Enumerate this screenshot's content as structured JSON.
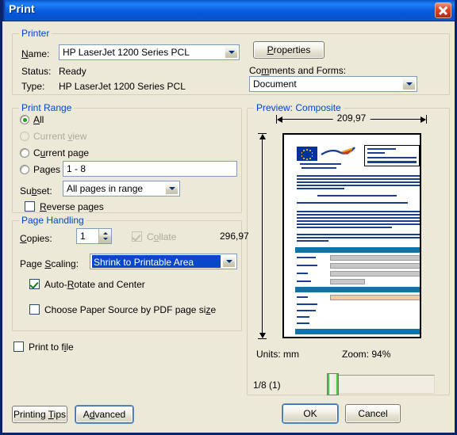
{
  "window": {
    "title": "Print",
    "close_label": "Close"
  },
  "printer": {
    "legend": "Printer",
    "name_label": "Name:",
    "name_value": "HP LaserJet 1200 Series PCL",
    "status_label": "Status:",
    "status_value": "Ready",
    "type_label": "Type:",
    "type_value": "HP LaserJet 1200 Series PCL",
    "properties_button": "Properties",
    "comments_label": "Comments and Forms:",
    "comments_value": "Document"
  },
  "print_range": {
    "legend": "Print Range",
    "all_label": "All",
    "all_checked": true,
    "current_view_label": "Current view",
    "current_view_enabled": false,
    "current_page_label": "Current page",
    "pages_label": "Pages",
    "pages_value": "1 - 8",
    "subset_label": "Subset:",
    "subset_value": "All pages in range",
    "reverse_label": "Reverse pages",
    "reverse_checked": false
  },
  "page_handling": {
    "legend": "Page Handling",
    "copies_label": "Copies:",
    "copies_value": "1",
    "collate_label": "Collate",
    "collate_checked": true,
    "collate_enabled": false,
    "scaling_label": "Page Scaling:",
    "scaling_value": "Shrink to Printable Area",
    "autorotate_label": "Auto-Rotate and Center",
    "autorotate_checked": true,
    "papersource_label": "Choose Paper Source by PDF page size",
    "papersource_checked": false
  },
  "print_to_file": {
    "label": "Print to file",
    "checked": false
  },
  "preview": {
    "legend": "Preview: Composite",
    "width_mm": "209,97",
    "height_mm": "296,97",
    "units_label": "Units: mm",
    "zoom_label": "Zoom:  94%",
    "page_indicator": "1/8 (1)"
  },
  "buttons": {
    "printing_tips": "Printing Tips",
    "advanced": "Advanced",
    "ok": "OK",
    "cancel": "Cancel"
  },
  "colors": {
    "dialog_face": "#ece9d8",
    "titlebar_blue": "#0a5ee0",
    "legend_blue": "#0046d5",
    "selection_blue": "#0a46c8",
    "close_red": "#c4341b",
    "check_green": "#12801a",
    "radio_green": "#19a419"
  }
}
